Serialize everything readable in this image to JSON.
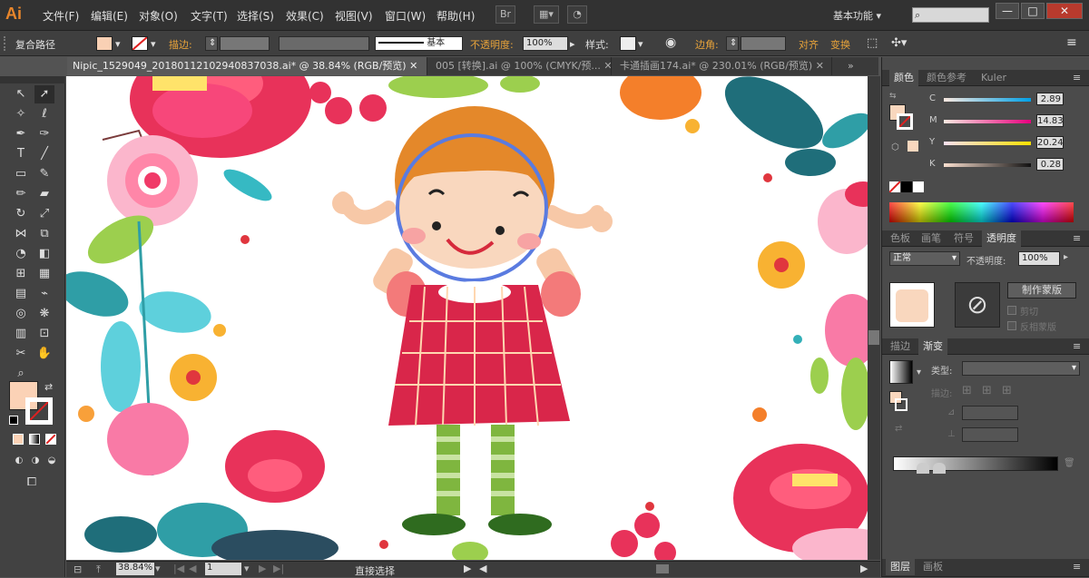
{
  "app": {
    "logo": "Ai"
  },
  "menu": [
    "文件(F)",
    "编辑(E)",
    "对象(O)",
    "文字(T)",
    "选择(S)",
    "效果(C)",
    "视图(V)",
    "窗口(W)",
    "帮助(H)"
  ],
  "workspace": {
    "label": "基本功能",
    "search_placeholder": ""
  },
  "window_controls": {
    "minimize": "—",
    "restore": "□",
    "close": "✕"
  },
  "control_bar": {
    "selection_type": "复合路径",
    "fill_color": "#f9d0b4",
    "stroke_label": "描边:",
    "stroke_style": "基本",
    "opacity_label": "不透明度:",
    "opacity_value": "100%",
    "style_label": "样式:",
    "corner_label": "边角:",
    "align_label": "对齐",
    "transform_label": "变换"
  },
  "doc_tabs": [
    {
      "label": "Nipic_1529049_20180112102940837038.ai* @ 38.84% (RGB/预览)",
      "close": "✕"
    },
    {
      "label": "005 [转换].ai @ 100% (CMYK/预...",
      "close": "✕"
    },
    {
      "label": "卡通插画174.ai* @ 230.01% (RGB/预览)",
      "close": "✕"
    }
  ],
  "tools": {
    "fill_color": "#fbd2b6"
  },
  "status_bar": {
    "zoom": "38.84%",
    "artboard": "1",
    "tool": "直接选择"
  },
  "color_panel": {
    "tabs": [
      "颜色",
      "颜色参考",
      "Kuler"
    ],
    "channels": [
      {
        "name": "C",
        "value": "2.89",
        "color": "#00a0e6"
      },
      {
        "name": "M",
        "value": "14.83",
        "color": "#e6007e"
      },
      {
        "name": "Y",
        "value": "20.24",
        "color": "#ffe100"
      },
      {
        "name": "K",
        "value": "0.28",
        "color": "#111111"
      }
    ],
    "current_color": "#f9d7be"
  },
  "transparency_panel": {
    "tabs": [
      "色板",
      "画笔",
      "符号",
      "透明度"
    ],
    "mode": "正常",
    "opacity_label": "不透明度:",
    "opacity_value": "100%",
    "make_mask": "制作蒙版",
    "clip": "剪切",
    "invert_mask": "反相蒙版"
  },
  "gradient_panel": {
    "tabs": [
      "描边",
      "渐变"
    ],
    "type_label": "类型:",
    "stroke_label": "描边:"
  },
  "bottom_panel": {
    "tabs": [
      "图层",
      "画板"
    ]
  }
}
